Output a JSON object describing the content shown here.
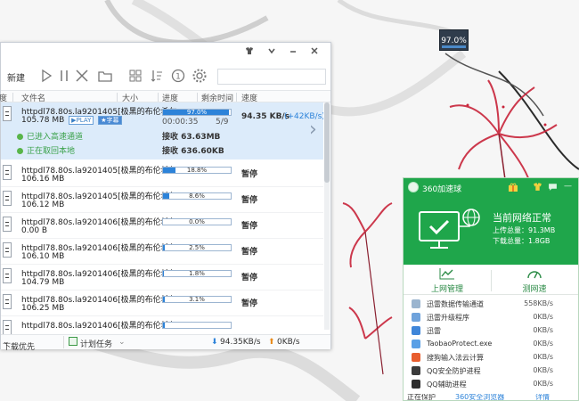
{
  "desktop": {
    "float_widget_value": "97.0%"
  },
  "downloader": {
    "toolbar": {
      "new_label": "新建"
    },
    "columns": {
      "status": "度",
      "filename": "文件名",
      "size": "大小",
      "progress": "进度",
      "remaining": "剩余时间",
      "speed": "速度"
    },
    "selected_task": {
      "name": "httpdl78.80s.la9201405[极黑的布伦希尔...",
      "size": "105.78 MB",
      "tag_play": "PLAY",
      "tag_sub": "字幕",
      "progress_label": "97.0%",
      "progress_fraction": 0.97,
      "elapsed": "00:00:35",
      "pieces": "5/9",
      "speed": "94.35 KB/s",
      "speed_extra": "(+42KB/s)",
      "channel_high_speed": "已进入高速通道",
      "channel_origin": "正在取回本地",
      "receive_high": "接收 63.63MB",
      "receive_origin": "接收 636.60KB"
    },
    "tasks": [
      {
        "name": "httpdl78.80s.la9201405[极黑的布伦希尔...",
        "size": "106.16 MB",
        "progress_label": "18.8%",
        "progress_fraction": 0.188,
        "status": "暂停"
      },
      {
        "name": "httpdl78.80s.la9201405[极黑的布伦希尔...",
        "size": "106.12 MB",
        "progress_label": "8.6%",
        "progress_fraction": 0.086,
        "status": "暂停"
      },
      {
        "name": "httpdl78.80s.la9201406[极黑的布伦希尔...",
        "size": "0.00 B",
        "progress_label": "0.0%",
        "progress_fraction": 0.0,
        "status": "暂停"
      },
      {
        "name": "httpdl78.80s.la9201406[极黑的布伦希尔...",
        "size": "106.10 MB",
        "progress_label": "2.5%",
        "progress_fraction": 0.025,
        "status": "暂停"
      },
      {
        "name": "httpdl78.80s.la9201406[极黑的布伦希尔...",
        "size": "104.79 MB",
        "progress_label": "1.8%",
        "progress_fraction": 0.018,
        "status": "暂停"
      },
      {
        "name": "httpdl78.80s.la9201406[极黑的布伦希尔...",
        "size": "106.25 MB",
        "progress_label": "3.1%",
        "progress_fraction": 0.031,
        "status": "暂停"
      },
      {
        "name": "httpdl78.80s.la9201406[极黑的布伦希尔...",
        "size": "",
        "progress_label": "",
        "progress_fraction": 0.02,
        "status": ""
      }
    ],
    "statusbar": {
      "download_first": "下载优先",
      "scheduled_tasks": "计划任务",
      "down_speed": "94.35KB/s",
      "up_speed": "0KB/s"
    }
  },
  "accelerator": {
    "title": "360加速球",
    "network_status": "当前网络正常",
    "upload_total": "上传总量：91.3MB",
    "download_total": "下载总量：1.8GB",
    "tab_traffic": "上网管理",
    "tab_speedtest": "测网速",
    "processes": [
      {
        "name": "迅雷数据传输通道",
        "speed": "558KB/s",
        "color": "#9bb5cf"
      },
      {
        "name": "迅雷升级程序",
        "speed": "0KB/s",
        "color": "#6fa3dc"
      },
      {
        "name": "迅雷",
        "speed": "0KB/s",
        "color": "#3f86d9"
      },
      {
        "name": "TaobaoProtect.exe",
        "speed": "0KB/s",
        "color": "#5aa0e6"
      },
      {
        "name": "搜狗输入法云计算",
        "speed": "0KB/s",
        "color": "#e85d2e"
      },
      {
        "name": "QQ安全防护进程",
        "speed": "0KB/s",
        "color": "#3b3b3b"
      },
      {
        "name": "QQ辅助进程",
        "speed": "0KB/s",
        "color": "#2e2e2e"
      }
    ],
    "footer_text": "正在保护",
    "footer_link": "360安全浏览器",
    "footer_detail": "详情",
    "colors": {
      "header_green": "#1fa64b",
      "accent_blue": "#2d83d9"
    }
  }
}
